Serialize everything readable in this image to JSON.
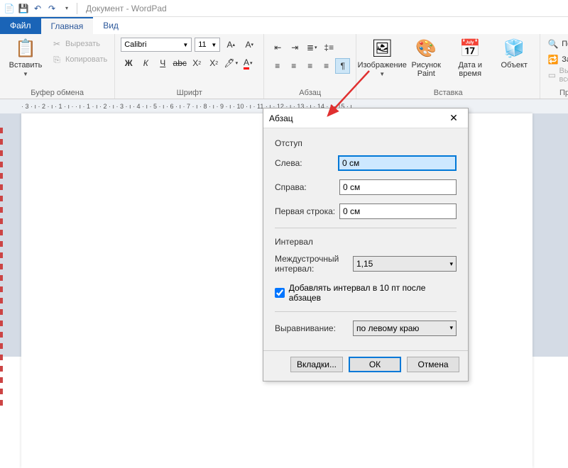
{
  "titlebar": {
    "doc_title": "Документ - WordPad"
  },
  "tabs": {
    "file": "Файл",
    "home": "Главная",
    "view": "Вид"
  },
  "ribbon": {
    "clipboard": {
      "paste": "Вставить",
      "cut": "Вырезать",
      "copy": "Копировать",
      "group": "Буфер обмена"
    },
    "font": {
      "name": "Calibri",
      "size": "11",
      "group": "Шрифт"
    },
    "paragraph": {
      "group": "Абзац"
    },
    "insert": {
      "image": "Изображение",
      "paint": "Рисунок Paint",
      "date": "Дата и время",
      "object": "Объект",
      "group": "Вставка"
    },
    "editing": {
      "find": "Поиск",
      "replace": "Замена",
      "select_all": "Выделить все",
      "group": "Правка"
    }
  },
  "ruler": "· 3 · ı · 2 · ı · 1 · ı ·    · ı · 1 · ı · 2 · ı · 3 · ı · 4 · ı · 5 · ı · 6 · ı · 7 · ı · 8 · ı · 9 · ı · 10 · ı · 11 · ı · 12 · ı · 13 · ı · 14 · ı · 15 · ı",
  "dialog": {
    "title": "Абзац",
    "indent_section": "Отступ",
    "left_label": "Слева:",
    "left_value": "0 см",
    "right_label": "Справа:",
    "right_value": "0 см",
    "first_label": "Первая строка:",
    "first_value": "0 см",
    "spacing_section": "Интервал",
    "line_spacing_label": "Междустрочный интервал:",
    "line_spacing_value": "1,15",
    "add_space_checkbox": "Добавлять интервал в 10 пт после абзацев",
    "align_label": "Выравнивание:",
    "align_value": "по левому краю",
    "tabs_btn": "Вкладки...",
    "ok_btn": "ОК",
    "cancel_btn": "Отмена"
  }
}
